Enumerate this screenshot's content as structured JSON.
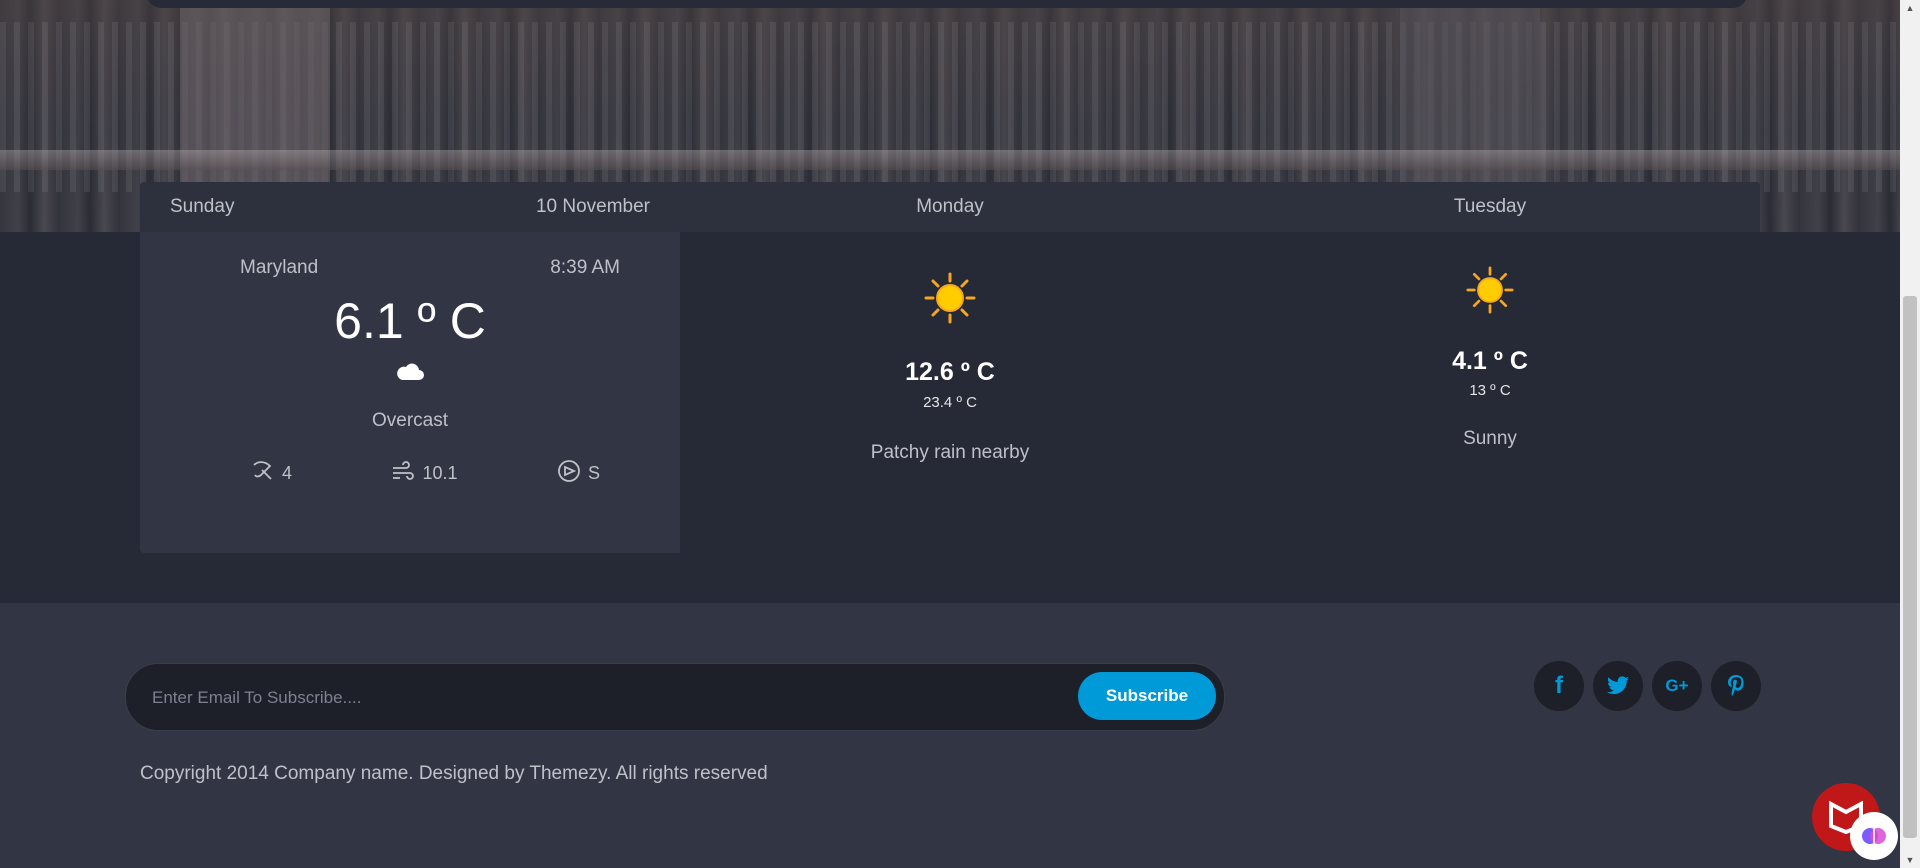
{
  "forecast": {
    "today": {
      "day": "Sunday",
      "date": "10  November",
      "location": "Maryland",
      "time": "8:39 AM",
      "temperature": "6.1 º C",
      "condition_icon": "cloud-icon",
      "condition": "Overcast",
      "stats": {
        "humidity": "4",
        "wind_speed": "10.1",
        "wind_direction": "S"
      }
    },
    "days": [
      {
        "day": "Monday",
        "icon": "sun-icon",
        "max": "12.6 º C",
        "min": "23.4 º C",
        "condition": "Patchy rain nearby"
      },
      {
        "day": "Tuesday",
        "icon": "sun-icon",
        "max": "4.1 º C",
        "min": "13 º C",
        "condition": "Sunny"
      }
    ]
  },
  "subscribe": {
    "placeholder": "Enter Email To Subscribe....",
    "button": "Subscribe"
  },
  "social": [
    "facebook-icon",
    "twitter-icon",
    "google-plus-icon",
    "pinterest-icon"
  ],
  "social_glyphs": {
    "facebook": "f",
    "google_plus": "G+"
  },
  "footer": {
    "copyright": "Copyright 2014 Company name. Designed by Themezy. All rights reserved"
  },
  "colors": {
    "accent": "#009ad8",
    "page_bg": "#262936",
    "footer_bg": "#323544"
  }
}
